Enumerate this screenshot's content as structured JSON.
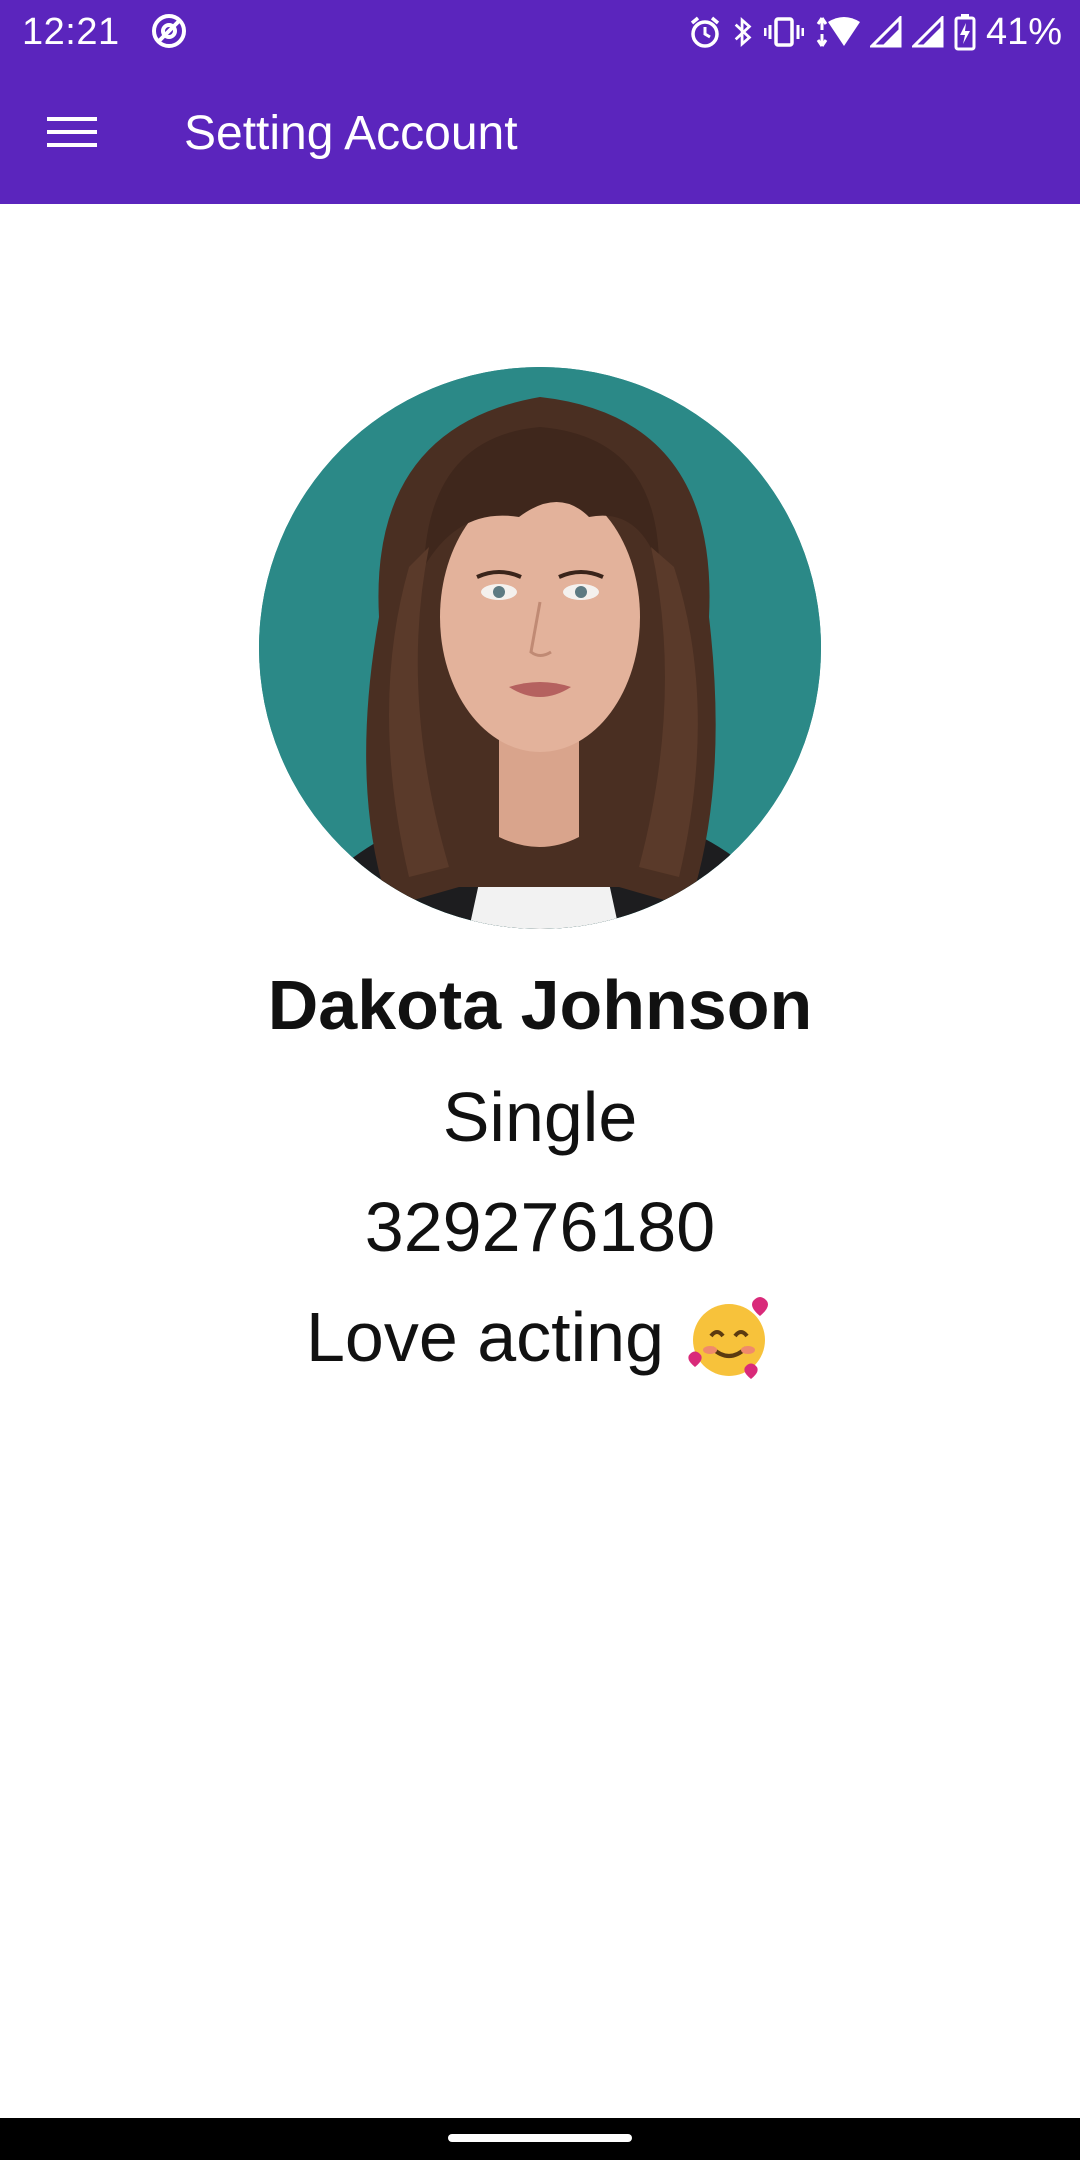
{
  "status_bar": {
    "time": "12:21",
    "battery": "41%",
    "icons": [
      "at-sign-icon",
      "alarm-icon",
      "bluetooth-icon",
      "vibrate-icon",
      "wifi-icon",
      "signal-icon",
      "signal-icon",
      "battery-charging-icon"
    ]
  },
  "app_bar": {
    "title": "Setting Account",
    "menu_icon": "hamburger-menu-icon",
    "color": "#5b25bd"
  },
  "profile": {
    "name": "Dakota Johnson",
    "status": "Single",
    "phone": "329276180",
    "bio": "Love acting",
    "bio_emoji": "smiling-face-with-hearts-icon"
  }
}
